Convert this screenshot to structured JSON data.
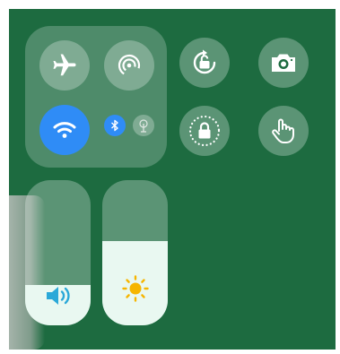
{
  "control_center": {
    "connectivity": {
      "airplane_mode": {
        "icon": "airplane-icon",
        "enabled": false
      },
      "airdrop": {
        "icon": "airdrop-icon",
        "enabled": false
      },
      "wifi": {
        "icon": "wifi-icon",
        "enabled": true,
        "color": "#2f8cf6"
      },
      "bluetooth": {
        "icon": "bluetooth-icon",
        "enabled": true,
        "color": "#2f8cf6"
      },
      "cellular": {
        "icon": "cellular-antenna-icon",
        "enabled": false
      }
    },
    "toggles": [
      {
        "name": "rotation-lock",
        "icon": "rotation-lock-icon"
      },
      {
        "name": "camera",
        "icon": "camera-icon"
      },
      {
        "name": "screen-lock",
        "icon": "lock-dotted-circle-icon"
      },
      {
        "name": "touch",
        "icon": "hand-pointer-icon"
      }
    ],
    "sliders": {
      "volume": {
        "icon": "speaker-icon",
        "level": 0.28,
        "icon_color": "#2aa8d8"
      },
      "brightness": {
        "icon": "sun-icon",
        "level": 0.58,
        "icon_color": "#f6b500"
      }
    },
    "background_color": "#1d6b40"
  }
}
